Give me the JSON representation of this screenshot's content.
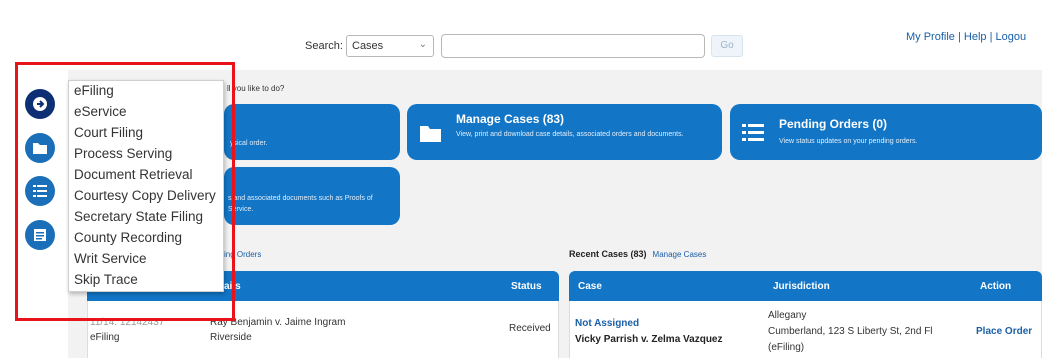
{
  "header": {
    "search_label": "Search:",
    "search_scope": "Cases",
    "search_value": "",
    "go_label": "Go",
    "links": {
      "profile": "My Profile",
      "sep1": " | ",
      "help": "Help",
      "sep2": " | ",
      "logout": "Logou"
    }
  },
  "main": {
    "prompt_partial": "ll you like to do?",
    "cards": [
      {
        "id": "place-order",
        "title": "",
        "desc": "ysical order."
      },
      {
        "id": "manage-cases",
        "title": "Manage Cases (83)",
        "desc": "View, print and download case details, associated orders and documents."
      },
      {
        "id": "pending-orders",
        "title": "Pending Orders (0)",
        "desc": "View status updates on your pending orders."
      },
      {
        "id": "documents",
        "title": "",
        "desc": "s and associated documents such as Proofs of Service."
      }
    ],
    "recent_orders": {
      "head_partial": "ing Orders",
      "columns": {
        "details": "ails",
        "status": "Status"
      },
      "row": {
        "num": "11/14: 12142437",
        "type": "eFiling",
        "parties": "Ray Benjamin v. Jaime Ingram",
        "location": "Riverside",
        "status": "Received"
      }
    },
    "recent_cases": {
      "title": "Recent Cases (83)",
      "link": "Manage Cases",
      "columns": {
        "case": "Case",
        "jurisdiction": "Jurisdiction",
        "action": "Action"
      },
      "row": {
        "case_number": "Not Assigned",
        "case_name": "Vicky Parrish v. Zelma Vazquez",
        "jurisdiction_1": "Allegany",
        "jurisdiction_2": "Cumberland, 123 S Liberty St, 2nd Fl",
        "jurisdiction_3": "(eFiling)",
        "action": "Place Order"
      }
    }
  },
  "menu": {
    "items": [
      "eFiling",
      "eService",
      "Court Filing",
      "Process Serving",
      "Document Retrieval",
      "Courtesy Copy Delivery",
      "Secretary State Filing",
      "County Recording",
      "Writ Service",
      "Skip Trace"
    ]
  },
  "rail_icons": [
    "arrow-right-icon",
    "folder-icon",
    "list-icon",
    "document-list-icon"
  ],
  "colors": {
    "accent": "#1275c6",
    "dark_accent": "#0d2f73",
    "highlight": "#e8141a"
  }
}
